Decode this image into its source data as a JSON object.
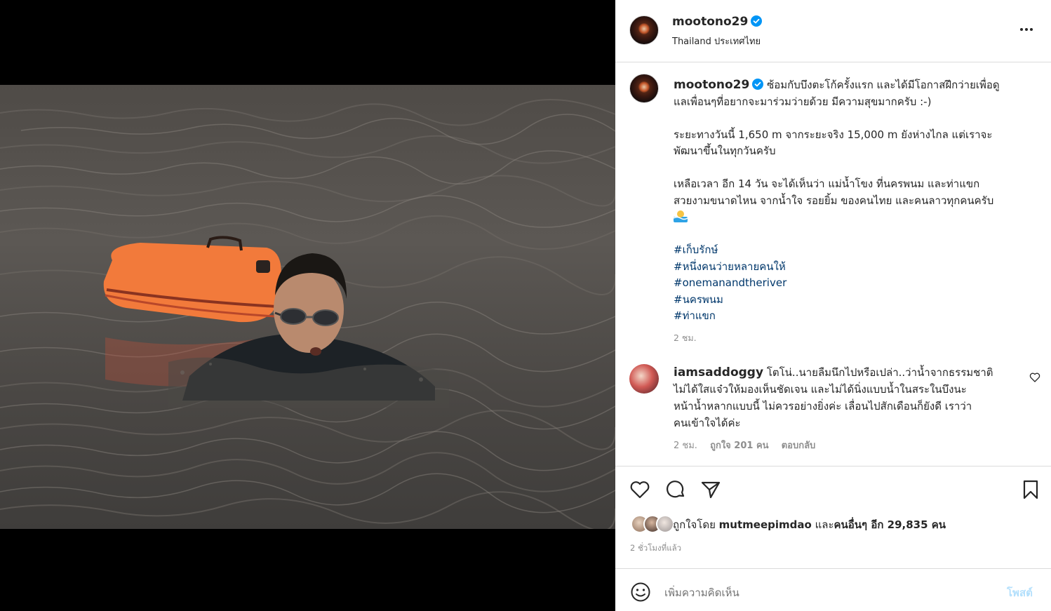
{
  "post": {
    "author": {
      "username": "mootono29",
      "location": "Thailand ประเทศไทย",
      "verified": true
    },
    "caption": {
      "username": "mootono29",
      "line1": "ซ้อมกับบึงตะโก้ครั้งแรก และได้มีโอกาสฝึกว่ายเพื่อดู",
      "line2": "แลเพื่อนๆที่อยากจะมาร่วมว่ายด้วย มีความสุขมากครับ :-)",
      "para2_line1": "ระยะทางวันนี้ 1,650 m จากระยะจริง 15,000 m ยังห่างไกล แต่เราจะ",
      "para2_line2": "พัฒนาขึ้นในทุกวันครับ",
      "para3_line1": "เหลือเวลา อีก 14 วัน จะได้เห็นว่า แม่น้ำโขง ที่นครพนม และท่าแขก",
      "para3_line2": "สวยงามขนาดไหน จากน้ำใจ รอยยิ้ม ของคนไทย และคนลาวทุกคนครับ",
      "emoji": "swimmer-emoji",
      "hashtags": [
        "#เก็บรักษ์",
        "#หนึ่งคนว่ายหลายคนให้",
        "#onemanandtheriver",
        "#นครพนม",
        "#ท่าแขก"
      ],
      "time": "2 ชม."
    },
    "comment": {
      "username": "iamsaddoggy",
      "line1": "โตโน่..นายลืมนึกไปหรือเปล่า..ว่าน้ำจากธรรมชาติ",
      "line2": "ไม่ได้ใสแจ๋วให้มองเห็นชัดเจน และไม่ได้นิ่งแบบน้ำในสระในบึงนะ",
      "line3": "หน้าน้ำหลากแบบนี้ ไม่ควรอย่างยิ่งค่ะ เลื่อนไปสักเดือนก็ยังดี เราว่า",
      "line4": "คนเข้าใจได้ค่ะ",
      "time": "2 ชม.",
      "likes": "ถูกใจ 201 คน",
      "reply": "ตอบกลับ"
    },
    "actions": {
      "like_icon": "heart-icon",
      "comment_icon": "comment-bubble-icon",
      "share_icon": "paper-plane-icon",
      "save_icon": "bookmark-icon"
    },
    "likes": {
      "prefix": "ถูกใจโดย",
      "liker": "mutmeepimdao",
      "middle": "และ",
      "others": "คนอื่นๆ อีก 29,835 คน"
    },
    "posted_ago": "2 ชั่วโมงที่แล้ว",
    "add_comment": {
      "placeholder": "เพิ่มความคิดเห็น",
      "post_label": "โพสต์"
    }
  },
  "colors": {
    "accent_blue": "#0095f6",
    "hashtag_blue": "#00376b",
    "post_btn_disabled": "#b2dffc",
    "muted": "#8e8e8e",
    "border": "#dbdbdb"
  }
}
